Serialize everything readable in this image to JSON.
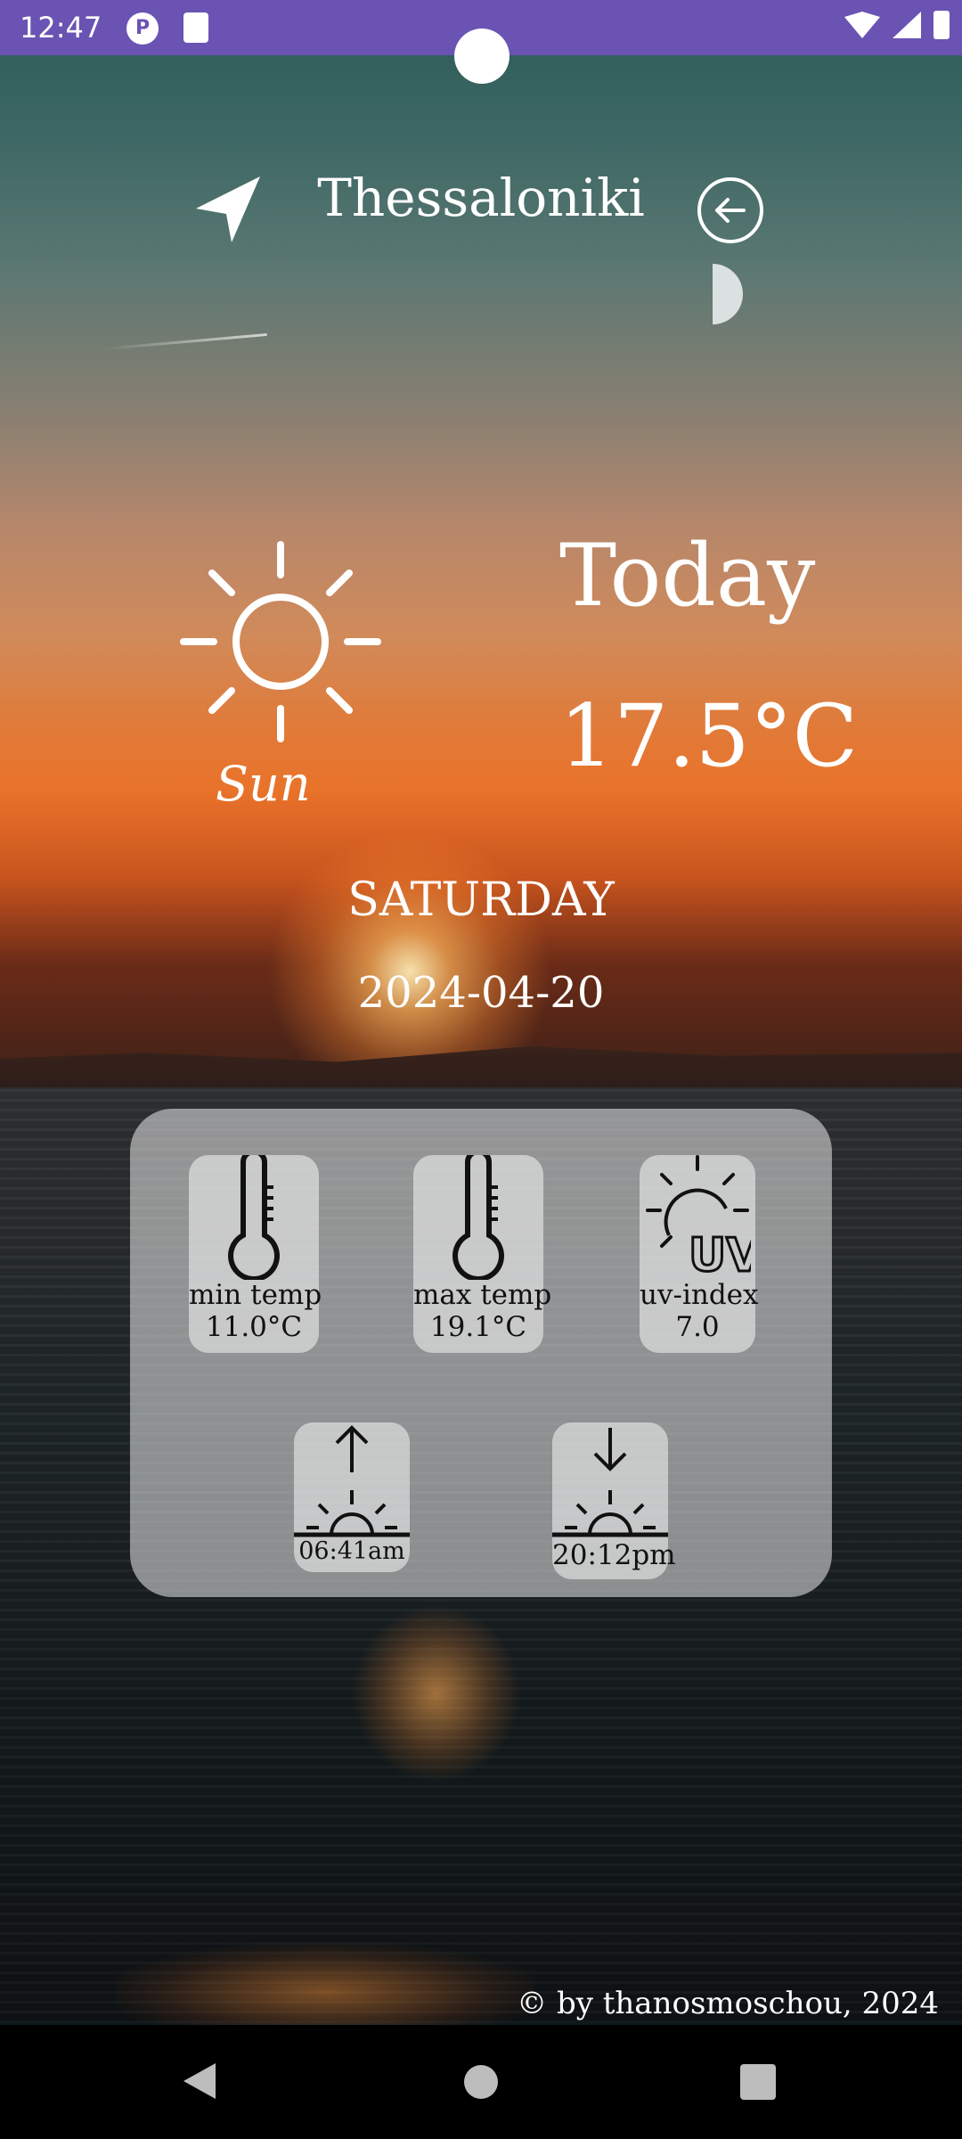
{
  "status_bar": {
    "time": "12:47",
    "icons": [
      "app-icon",
      "sd-card-icon",
      "wifi-icon",
      "signal-icon",
      "battery-icon"
    ]
  },
  "header": {
    "city": "Thessaloniki",
    "location_icon": "navigation-arrow-icon",
    "back_icon": "back-arrow-circle-icon"
  },
  "weather": {
    "condition_icon": "sun-icon",
    "condition": "Sun",
    "label": "Today",
    "temperature": "17.5°C",
    "day": "SATURDAY",
    "date": "2024-04-20"
  },
  "details": {
    "min_temp": {
      "label": "min temp",
      "value": "11.0°C",
      "icon": "thermometer-icon"
    },
    "max_temp": {
      "label": "max temp",
      "value": "19.1°C",
      "icon": "thermometer-icon"
    },
    "uv_index": {
      "label": "uv-index",
      "value": "7.0",
      "icon": "uv-sun-icon"
    },
    "sunrise": {
      "value": "06:41am",
      "icon": "sunrise-icon"
    },
    "sunset": {
      "value": "20:12pm",
      "icon": "sunset-icon"
    }
  },
  "footer": {
    "copyright": "© by thanosmoschou, 2024"
  },
  "colors": {
    "status_bar": "#6a53b3",
    "text": "#ffffff",
    "card": "#ebebeb"
  }
}
